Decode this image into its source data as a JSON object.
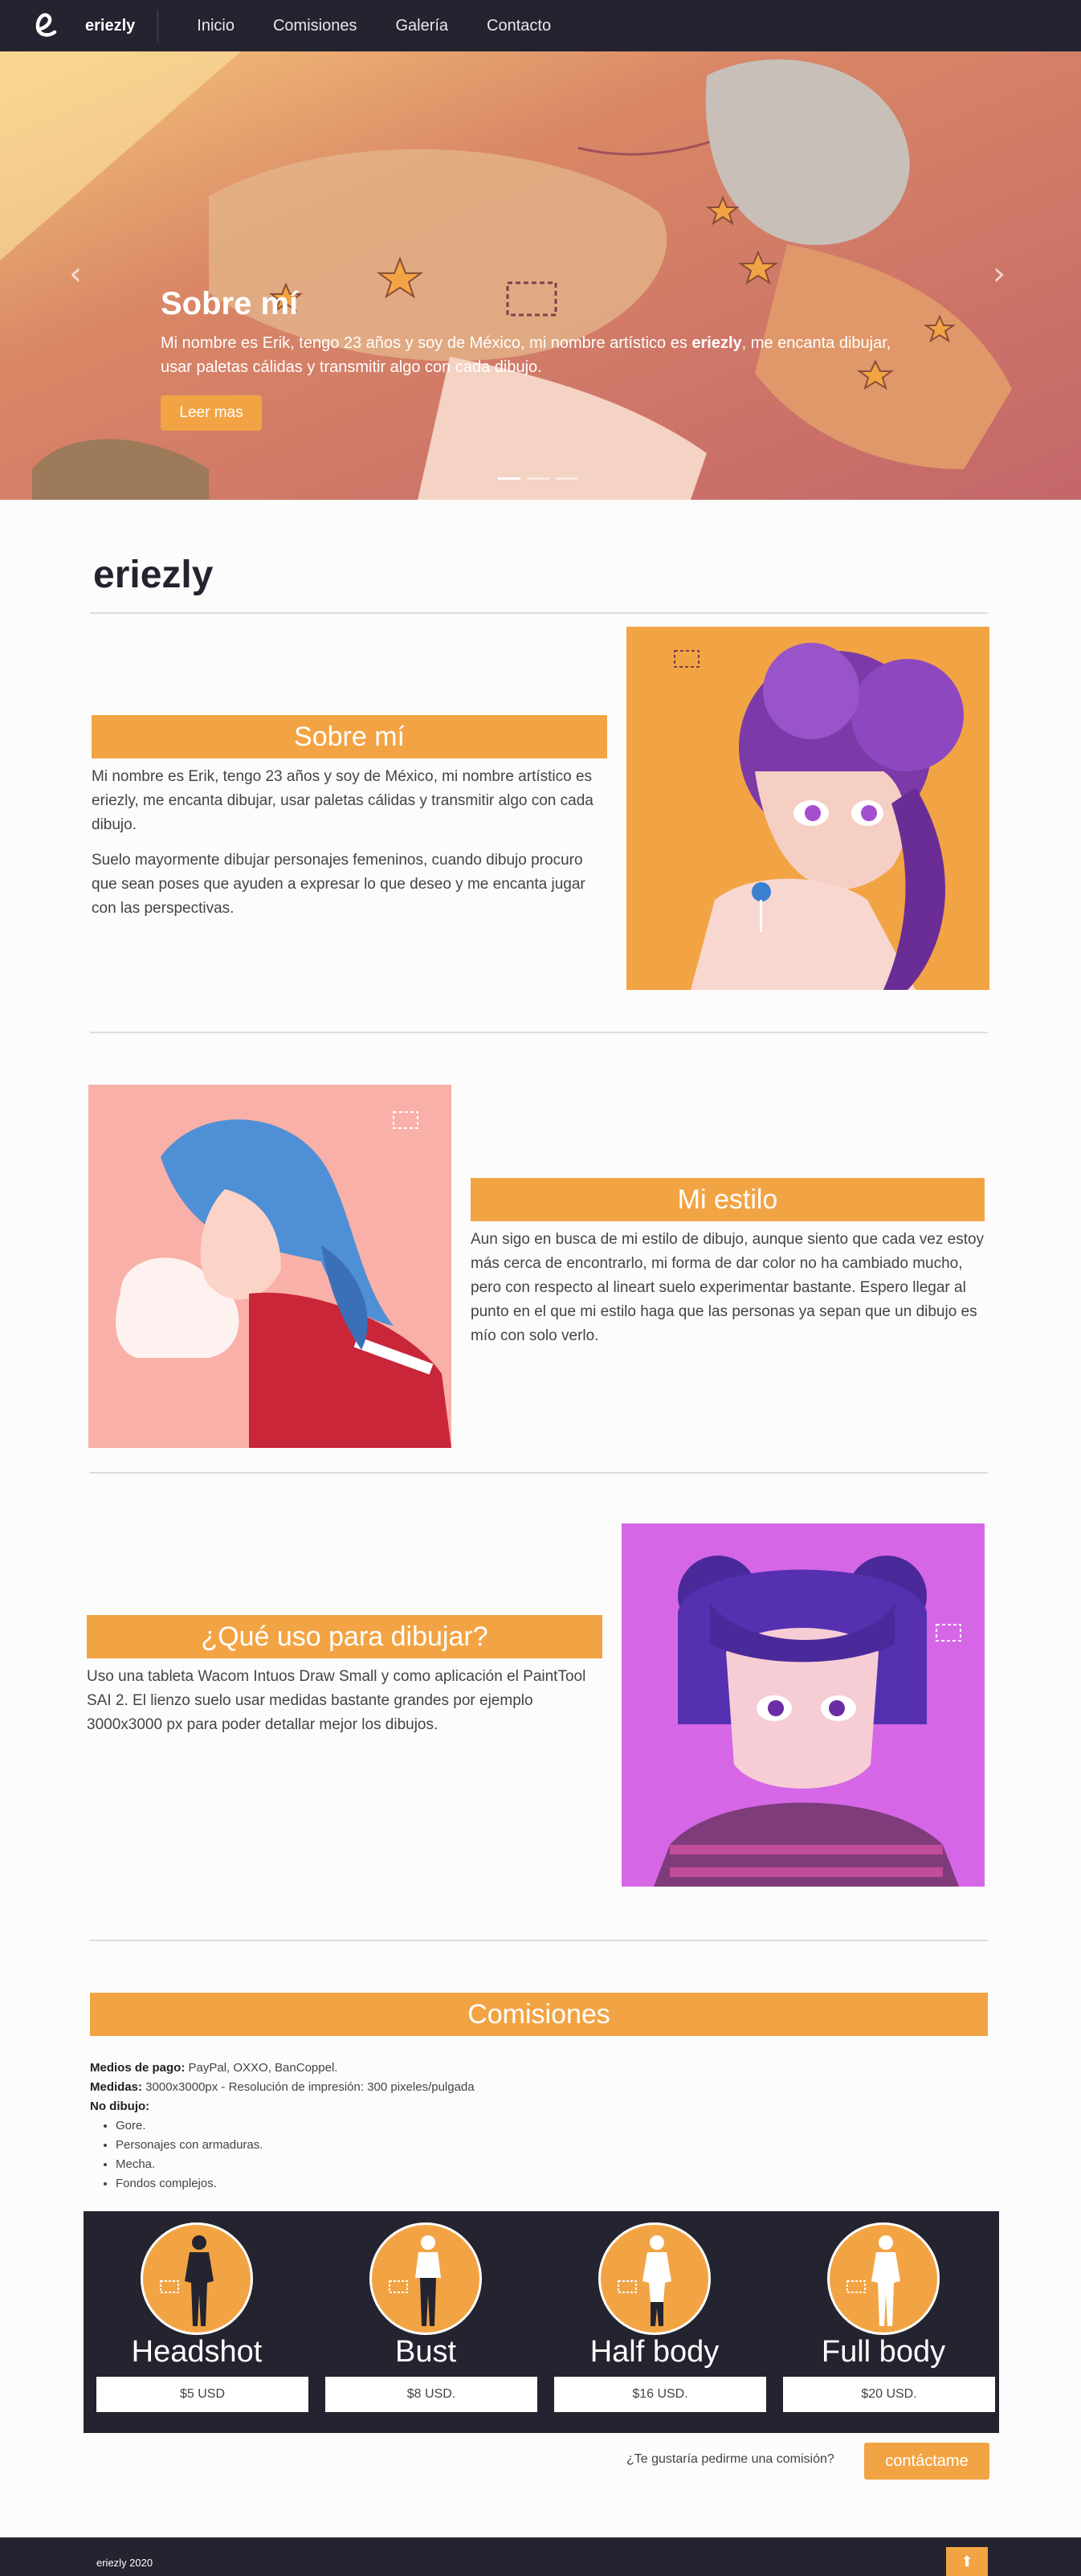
{
  "navbar": {
    "brand": "eriezly",
    "items": [
      "Inicio",
      "Comisiones",
      "Galería",
      "Contacto"
    ]
  },
  "hero": {
    "title": "Sobre mí",
    "text_before": "Mi nombre es Erik, tengo 23 años y soy de México, mi nombre artístico es ",
    "text_bold": "eriezly",
    "text_after": ", me encanta dibujar, usar paletas cálidas y transmitir algo con cada dibujo.",
    "button_label": "Leer mas",
    "prev_label": "‹",
    "next_label": "›"
  },
  "site_title": "eriezly",
  "about": {
    "title": "Sobre mí",
    "paragraphs": [
      "Mi nombre es Erik, tengo 23 años y soy de México, mi nombre artístico es eriezly, me encanta dibujar, usar paletas cálidas y transmitir algo con cada dibujo.",
      "Suelo mayormente dibujar personajes femeninos, cuando dibujo procuro que sean poses que ayuden a expresar lo que deseo y me encanta jugar con las perspectivas."
    ]
  },
  "style": {
    "title": "Mi estilo",
    "text": "Aun sigo en busca de mi estilo de dibujo, aunque siento que cada vez estoy más cerca de encontrarlo, mi forma de dar color no ha cambiado mucho, pero con respecto al lineart suelo experimentar bastante. Espero llegar al punto en el que mi estilo haga que las personas ya sepan que un dibujo es mío con solo verlo."
  },
  "tools": {
    "title": "¿Qué uso para dibujar?",
    "text": "Uso una tableta Wacom Intuos Draw Small y como aplicación el PaintTool SAI 2. El lienzo suelo usar medidas bastante grandes por ejemplo 3000x3000 px para poder detallar mejor los dibujos."
  },
  "commissions": {
    "title": "Comisiones",
    "payment_label": "Medios de pago:",
    "payment_value": " PayPal, OXXO, BanCoppel.",
    "size_label": "Medidas:",
    "size_value": " 3000x3000px - Resolución de impresión: 300 pixeles/pulgada",
    "no_draw_label": "No dibujo:",
    "no_draw_items": [
      "Gore.",
      "Personajes con armaduras.",
      "Mecha.",
      "Fondos complejos."
    ],
    "tiers": [
      {
        "name": "Headshot",
        "price": "$5 USD"
      },
      {
        "name": "Bust",
        "price": "$8 USD."
      },
      {
        "name": "Half body",
        "price": "$16 USD."
      },
      {
        "name": "Full body",
        "price": "$20 USD."
      }
    ],
    "contact_question": "¿Te gustaría pedirme una comisión?",
    "contact_button": "contáctame"
  },
  "footer": {
    "text": "eriezly 2020",
    "to_top": "⬆"
  },
  "colors": {
    "accent": "#f2a444",
    "dark": "#23242f"
  }
}
